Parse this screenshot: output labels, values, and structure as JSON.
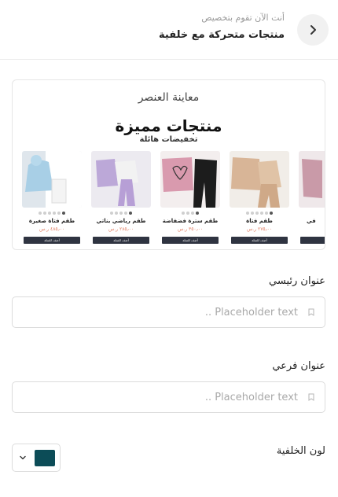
{
  "header": {
    "subtitle": "أنت الآن تقوم بتخصيص",
    "title": "منتجات متحركة مع خلفية",
    "back_icon": "chevron-right-icon"
  },
  "preview": {
    "label": "معاينة العنصر",
    "promo_title": "منتجات مميزة",
    "promo_subtitle": "تخفيضات هائلة",
    "products": [
      {
        "name": "طقم فتاة صغيرة",
        "price": "٤٨٥٫٠٠ ر.س",
        "button": "أضف للسلة"
      },
      {
        "name": "طقم رياضي بناتي",
        "price": "٢٨٥٫٠٠ ر.س",
        "button": "أضف للسلة"
      },
      {
        "name": "طقم سترة فضفاضة",
        "price": "٣٥٠٫٠٠ ر.س",
        "button": "أضف للسلة"
      },
      {
        "name": "طقم فتاة",
        "price": "٢٧٥٫٠٠ ر.س",
        "button": "أضف للسلة"
      },
      {
        "name": "في",
        "price": "",
        "button": ""
      }
    ]
  },
  "main_title": {
    "label": "عنوان رئيسي",
    "placeholder": "Placeholder text ..",
    "value": ""
  },
  "sub_title": {
    "label": "عنوان فرعي",
    "placeholder": "Placeholder text ..",
    "value": ""
  },
  "background_color": {
    "label": "لون الخلفية",
    "value": "#0c4c57"
  },
  "colors": {
    "accent": "#0c4c57",
    "price": "#e07a5f",
    "cart_button": "#2f3441"
  }
}
